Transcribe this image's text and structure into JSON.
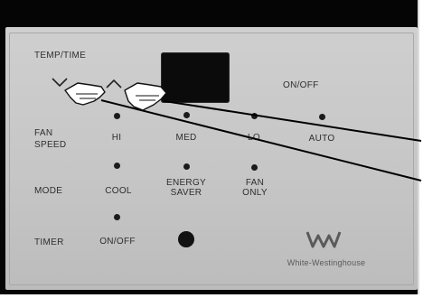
{
  "panel": {
    "temp_time_label": "TEMP/TIME",
    "on_off_label": "ON/OFF",
    "fan_speed_label": "FAN SPEED",
    "mode_label": "MODE",
    "timer_label": "TIMER",
    "fan_options": [
      "HI",
      "MED",
      "LO",
      "AUTO"
    ],
    "mode_options": [
      "COOL",
      "ENERGY SAVER",
      "FAN ONLY"
    ],
    "timer_option": "ON/OFF",
    "brand": "White-Westinghouse",
    "colors": {
      "panel": "#c8c8c8",
      "frame": "#050505",
      "display": "#0b0b0b"
    }
  }
}
